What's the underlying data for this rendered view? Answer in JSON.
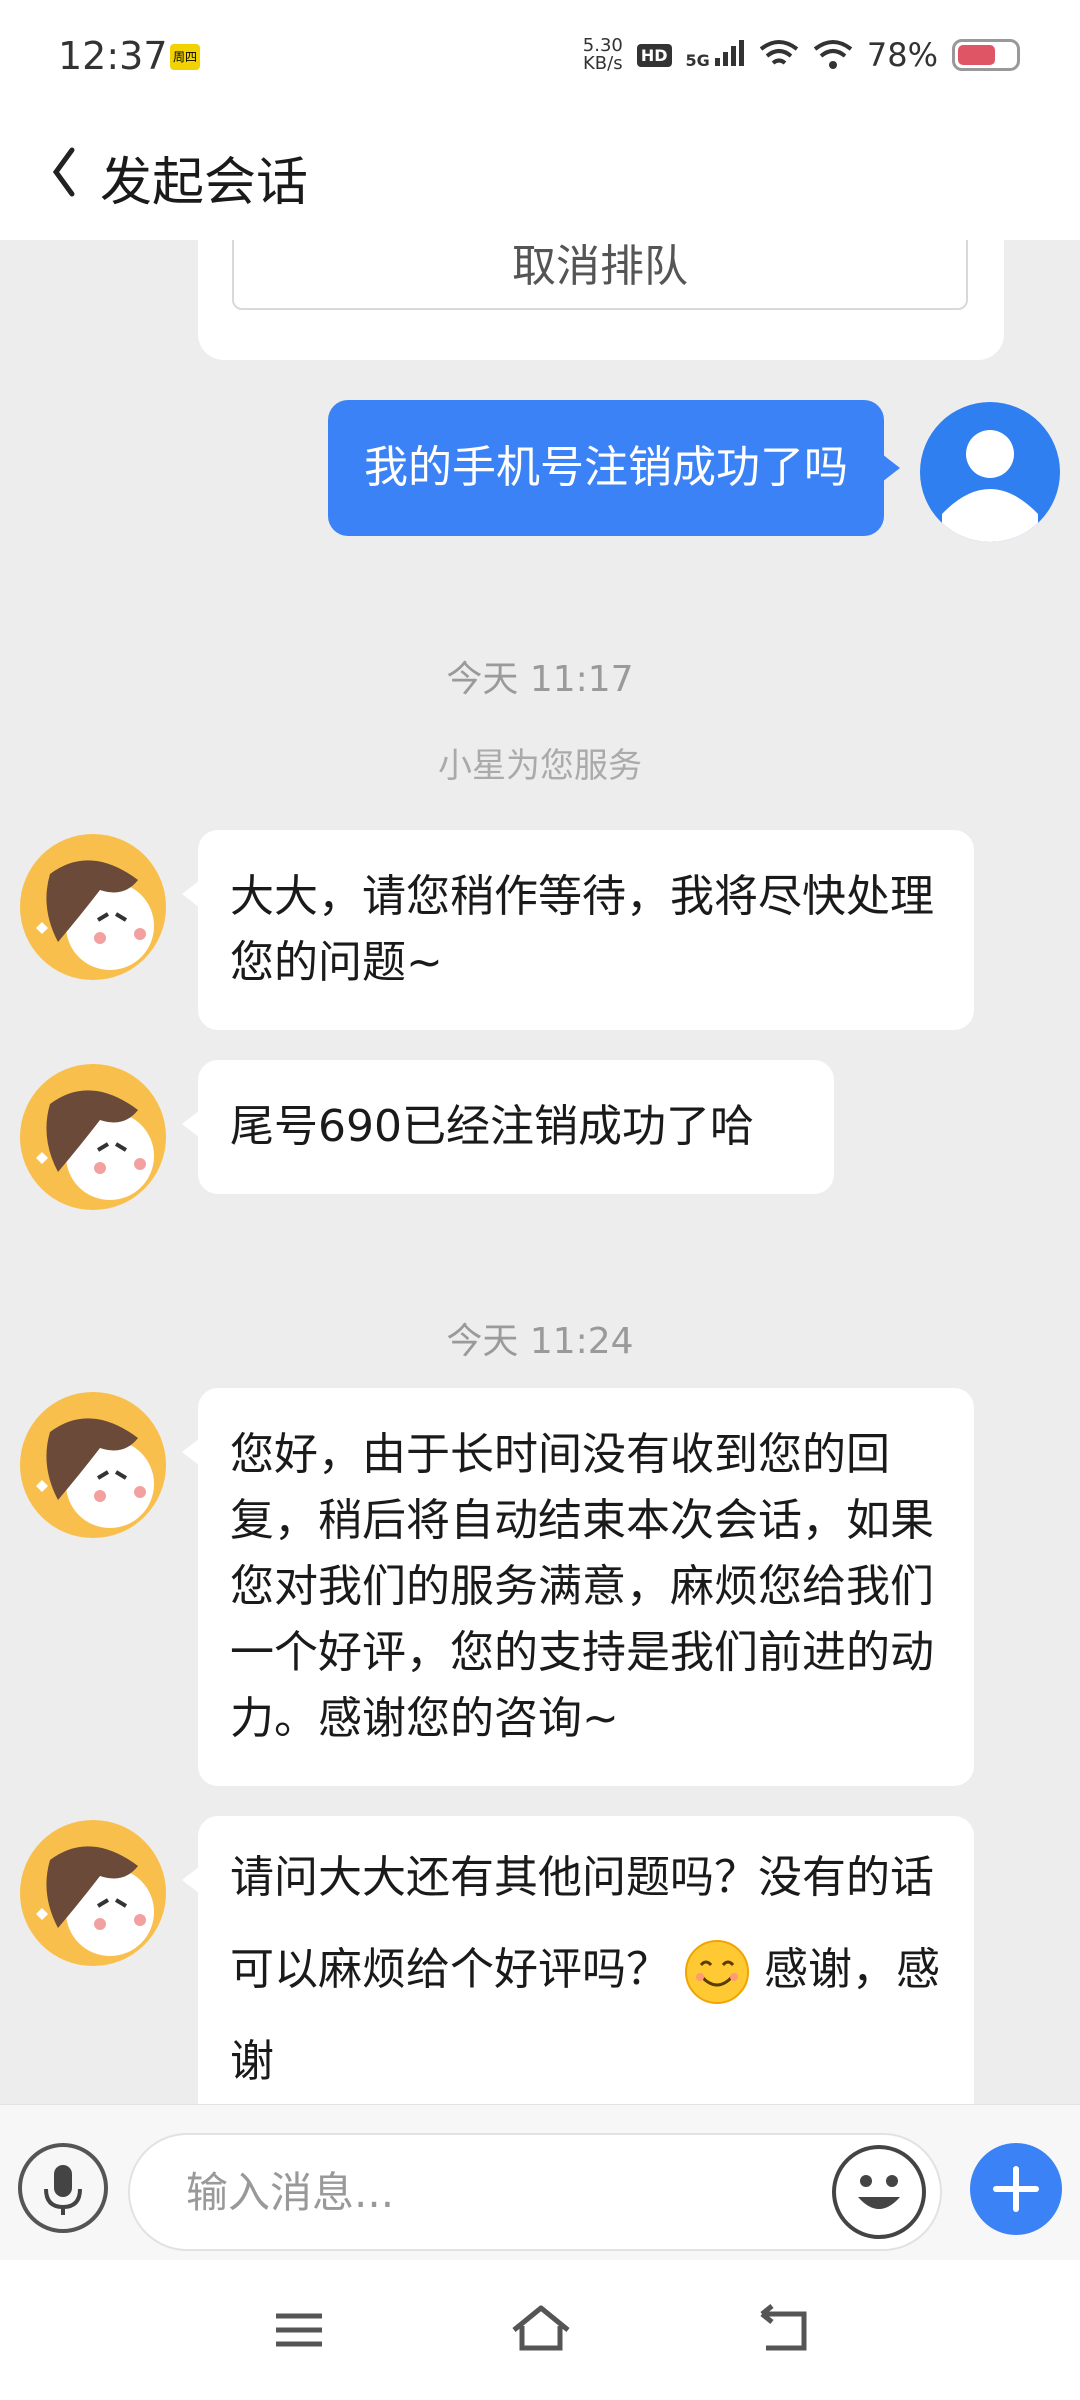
{
  "status_bar": {
    "time": "12:37",
    "badge": "周四",
    "net_speed_value": "5.30",
    "net_speed_unit": "KB/s",
    "hd": "HD",
    "network": "5G",
    "battery_percent": "78%",
    "battery_level": 0.78
  },
  "header": {
    "title": "发起会话"
  },
  "chat": {
    "cancel_queue_label": "取消排队",
    "user_message": "我的手机号注销成功了吗",
    "time_1": "今天 11:17",
    "service_note": "小星为您服务",
    "agent_msg_1": "大大，请您稍作等待，我将尽快处理您的问题~",
    "agent_msg_2": "尾号690已经注销成功了哈",
    "time_2": "今天 11:24",
    "agent_msg_3": "您好，由于长时间没有收到您的回复，稍后将自动结束本次会话，如果您对我们的服务满意，麻烦您给我们一个好评，您的支持是我们前进的动力。感谢您的咨询~",
    "agent_msg_4_part1": "请问大大还有其他问题吗？没有的话可以麻烦给个好评吗？",
    "agent_msg_4_part2": "感谢，感谢"
  },
  "input_bar": {
    "placeholder": "输入消息..."
  },
  "colors": {
    "accent": "#3b82f6",
    "background": "#ededed",
    "agent_avatar": "#f9bf4c"
  },
  "icons": {
    "mic": "microphone-icon",
    "emoji": "emoji-smile-icon",
    "plus": "plus-icon",
    "back": "chevron-left-icon",
    "menu": "menu-icon",
    "home": "home-icon",
    "return": "back-nav-icon"
  }
}
